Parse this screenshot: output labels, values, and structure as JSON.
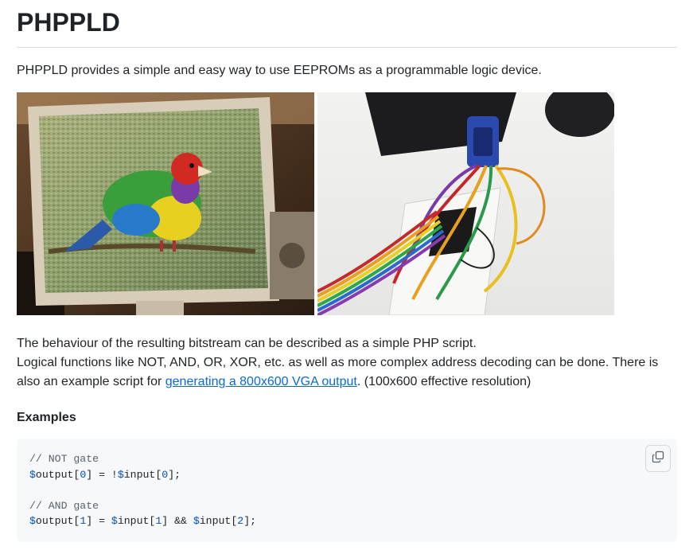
{
  "title": "PHPPLD",
  "intro": "PHPPLD provides a simple and easy way to use EEPROMs as a programmable logic device.",
  "images": [
    {
      "alt": "VGA monitor showing pixelated colorful bird"
    },
    {
      "alt": "Breadboard with EEPROMs wired to a VGA connector"
    }
  ],
  "description": {
    "line1": "The behaviour of the resulting bitstream can be described as a simple PHP script.",
    "line2_prefix": "Logical functions like NOT, AND, OR, XOR, etc. as well as more complex address decoding can be done. There is also an example script for ",
    "link_text": "generating a 800x600 VGA output",
    "line2_suffix": ". (100x600 effective resolution)"
  },
  "examples_heading": "Examples",
  "code": {
    "comment1": "// NOT gate",
    "comment2": "// AND gate",
    "tokens": {
      "dollar": "$",
      "output": "output",
      "input": "input",
      "open": "[",
      "close": "]",
      "n0": "0",
      "n1": "1",
      "n2": "2",
      "assign": " = ",
      "not": "!",
      "and": " && ",
      "semicolon": ";"
    }
  },
  "colors": {
    "link": "#0969da",
    "code_bg": "#f6f8fa",
    "code_comment": "#59636e",
    "code_variable": "#0550ae"
  },
  "icons": {
    "copy": "copy-icon"
  }
}
